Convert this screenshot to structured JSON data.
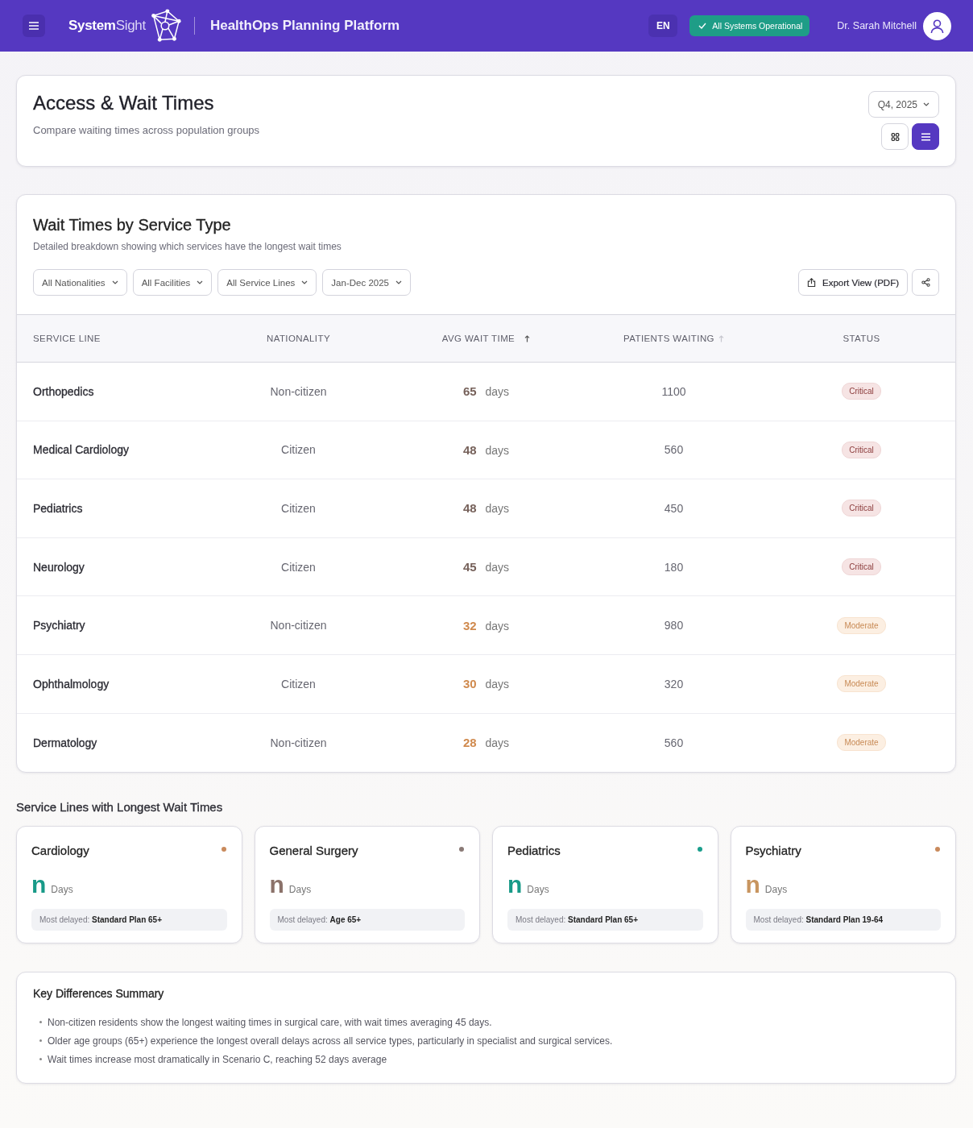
{
  "header": {
    "logo": "**System**Sight",
    "app_title": "HealthOps Planning Platform",
    "language": "EN",
    "system_status": {
      "label": "All Systems Operational",
      "kind": "ok"
    },
    "user_name": "Dr. Sarah Mitchell"
  },
  "page_header": {
    "title": "Access & Wait Times",
    "subtitle": "Compare waiting times across population groups",
    "period": "Q4, 2025",
    "view_toggle": [
      {
        "kind": "grid",
        "selected": false
      },
      {
        "kind": "list",
        "selected": true
      }
    ]
  },
  "wait_table": {
    "title": "Wait Times by Service Type",
    "subtitle": "Detailed breakdown showing which services have the longest wait times",
    "filters": [
      "All Nationalities",
      "All Facilities",
      "All Service Lines",
      "Jan-Dec 2025"
    ],
    "export_label": "Export View (PDF)",
    "columns": [
      {
        "label": "SERVICE LINE",
        "sortable": false
      },
      {
        "label": "NATIONALITY",
        "sortable": false
      },
      {
        "label": "AVG WAIT TIME",
        "sortable": true,
        "sorted": true
      },
      {
        "label": "PATIENTS WAITING",
        "sortable": true,
        "sorted": false
      },
      {
        "label": "STATUS",
        "sortable": false
      }
    ],
    "rows": [
      {
        "service_line": "Orthopedics",
        "nationality": "Non-citizen",
        "avg_wait": "**65** days",
        "patients_waiting": "1100",
        "status": {
          "label": "Critical",
          "kind": "critical"
        }
      },
      {
        "service_line": "Medical Cardiology",
        "nationality": "Citizen",
        "avg_wait": "**48** days",
        "patients_waiting": "560",
        "status": {
          "label": "Critical",
          "kind": "critical"
        }
      },
      {
        "service_line": "Pediatrics",
        "nationality": "Citizen",
        "avg_wait": "**48** days",
        "patients_waiting": "450",
        "status": {
          "label": "Critical",
          "kind": "critical"
        }
      },
      {
        "service_line": "Neurology",
        "nationality": "Citizen",
        "avg_wait": "**45** days",
        "patients_waiting": "180",
        "status": {
          "label": "Critical",
          "kind": "critical"
        }
      },
      {
        "service_line": "Psychiatry",
        "nationality": "Non-citizen",
        "avg_wait": "**32** days",
        "patients_waiting": "980",
        "status": {
          "label": "Moderate",
          "kind": "moderate"
        }
      },
      {
        "service_line": "Ophthalmology",
        "nationality": "Citizen",
        "avg_wait": "**30** days",
        "patients_waiting": "320",
        "status": {
          "label": "Moderate",
          "kind": "moderate"
        }
      },
      {
        "service_line": "Dermatology",
        "nationality": "Non-citizen",
        "avg_wait": "**28** days",
        "patients_waiting": "560",
        "status": {
          "label": "Moderate",
          "kind": "moderate"
        }
      }
    ]
  },
  "longest_waits": {
    "title": "Service Lines with Longest Wait Times",
    "cards": [
      {
        "name": "Cardiology",
        "dot": {
          "color": "#c98a5c"
        },
        "value": {
          "text": "n",
          "color": "#189a88"
        },
        "unit": "Days",
        "most_delayed": "Most delayed: **Standard Plan 65+**"
      },
      {
        "name": "General Surgery",
        "dot": {
          "color": "#8a7a76"
        },
        "value": {
          "text": "n",
          "color": "#8b726a"
        },
        "unit": "Days",
        "most_delayed": "Most delayed: **Age 65+**"
      },
      {
        "name": "Pediatrics",
        "dot": {
          "color": "#1a9e8c"
        },
        "value": {
          "text": "n",
          "color": "#189a88"
        },
        "unit": "Days",
        "most_delayed": "Most delayed: **Standard Plan 65+**"
      },
      {
        "name": "Psychiatry",
        "dot": {
          "color": "#c98a5c"
        },
        "value": {
          "text": "n",
          "color": "#c8955f"
        },
        "unit": "Days",
        "most_delayed": "Most delayed: **Standard Plan 19-64**"
      }
    ]
  },
  "summary": {
    "title": "Key Differences Summary",
    "points": [
      "Non-citizen residents show the longest waiting times in surgical care, with wait times averaging 45 days.",
      "Older age groups (65+) experience the longest overall delays across all service types, particularly in specialist and surgical services.",
      "Wait times increase most dramatically in Scenario C, reaching 52 days average"
    ]
  }
}
